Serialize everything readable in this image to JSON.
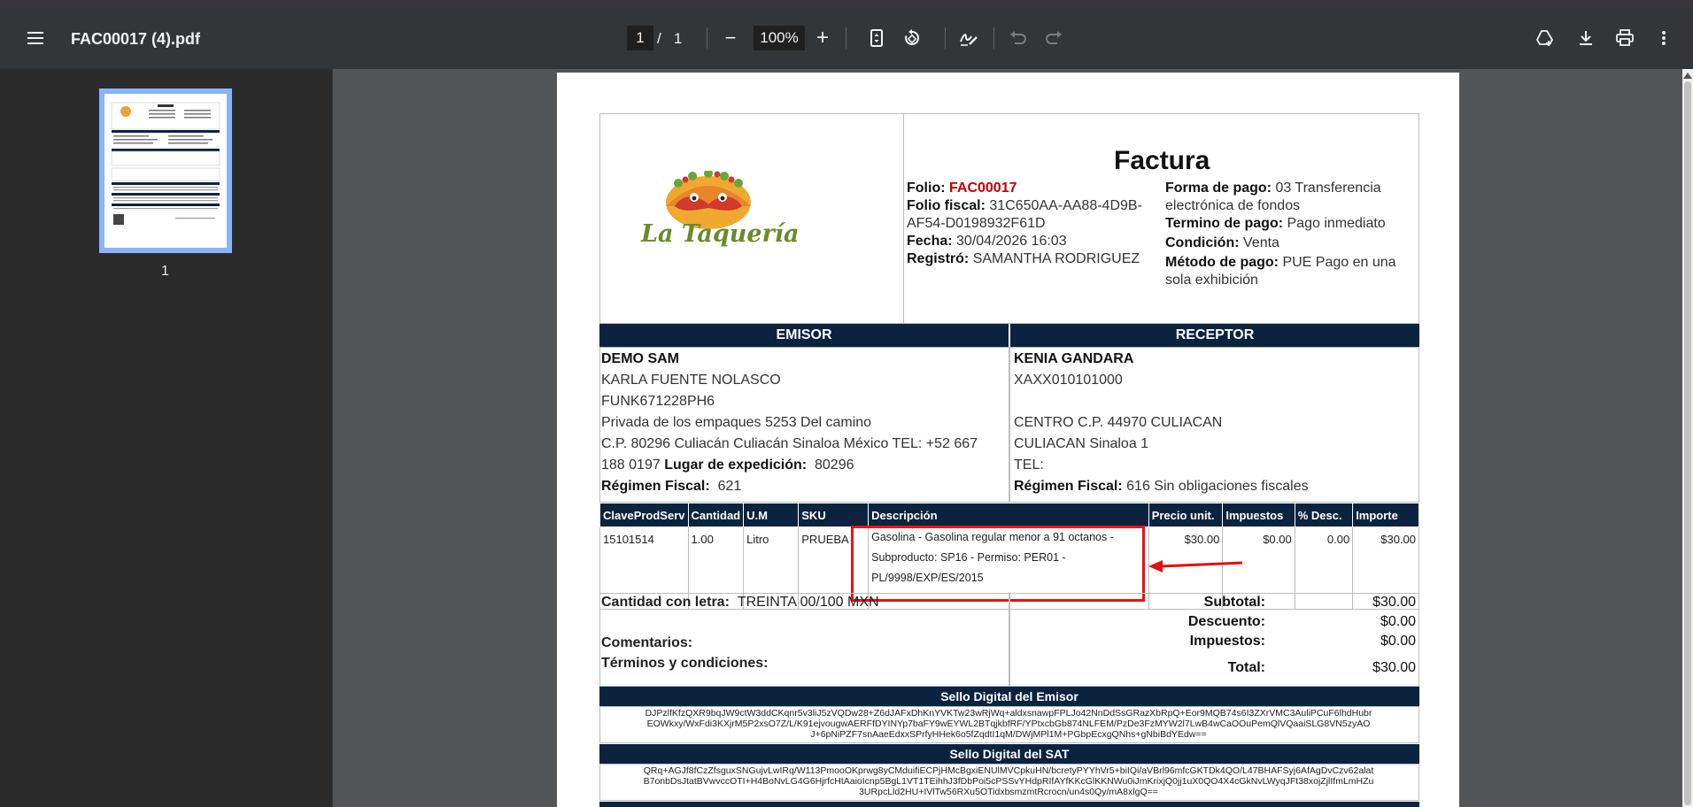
{
  "toolbar": {
    "filename": "FAC00017 (4).pdf",
    "page_current": "1",
    "page_sep": "/",
    "page_total": "1",
    "zoom": "100%",
    "zoom_out_glyph": "−",
    "zoom_in_glyph": "+",
    "icons": {
      "menu": "hamburger-menu-icon",
      "fit": "fit-to-page-icon",
      "rotate": "rotate-icon",
      "annotate": "draw-annotation-icon",
      "undo": "undo-icon",
      "redo": "redo-icon",
      "drive": "save-to-drive-icon",
      "download": "download-icon",
      "print": "print-icon",
      "more": "more-vertical-icon"
    }
  },
  "sidebar": {
    "thumbnail_label": "1"
  },
  "invoice": {
    "logo_text": "La Taquería",
    "title": "Factura",
    "left_info": {
      "folio_label": "Folio:",
      "folio_value": "FAC00017",
      "folio_fiscal_label": "Folio fiscal:",
      "folio_fiscal_value_1": "31C650AA-AA88-4D9B-",
      "folio_fiscal_value_2": "AF54-D0198932F61D",
      "fecha_label": "Fecha:",
      "fecha_value": "30/04/2026 16:03",
      "registro_label": "Registró:",
      "registro_value": "SAMANTHA RODRIGUEZ"
    },
    "right_info": {
      "forma_label": "Forma de pago:",
      "forma_value_1": "03 Transferencia",
      "forma_value_2": "electrónica de fondos",
      "termino_label": "Termino de pago:",
      "termino_value": "Pago inmediato",
      "condicion_label": "Condición:",
      "condicion_value": "Venta",
      "metodo_label": "Método de pago:",
      "metodo_value_1": "PUE Pago en una",
      "metodo_value_2": "sola exhibición"
    },
    "emisor": {
      "header": "EMISOR",
      "name": "DEMO SAM",
      "line1": "KARLA FUENTE NOLASCO",
      "line2": "FUNK671228PH6",
      "line3": "Privada de los empaques 5253 Del camino",
      "line4": "C.P. 80296 Culiacán Culiacán Sinaloa México TEL: +52 667",
      "line5_pre": "188 0197",
      "lugar_label": "Lugar de expedición:",
      "lugar_value": "80296",
      "regimen_label": "Régimen Fiscal:",
      "regimen_value": "621"
    },
    "receptor": {
      "header": "RECEPTOR",
      "name": "KENIA GANDARA",
      "line1": "XAXX010101000",
      "line2": "",
      "line3": "CENTRO C.P. 44970  CULIACAN",
      "line4": "CULIACAN Sinaloa 1",
      "line5": "TEL:",
      "regimen_label": "Régimen Fiscal:",
      "regimen_value": "616 Sin obligaciones fiscales"
    },
    "items_table": {
      "headers": [
        "ClaveProdServ",
        "Cantidad",
        "U.M",
        "SKU",
        "Descripción",
        "Precio unit.",
        "Impuestos",
        "% Desc.",
        "Importe"
      ],
      "rows": [
        {
          "clave": "15101514",
          "cantidad": "1.00",
          "um": "Litro",
          "sku": "PRUEBA",
          "descripcion_1": "Gasolina - Gasolina regular menor a 91 octanos -",
          "descripcion_2": "Subproducto: SP16 - Permiso: PER01 -",
          "descripcion_3": "PL/9998/EXP/ES/2015",
          "precio": "$30.00",
          "impuestos": "$0.00",
          "desc": "0.00",
          "importe": "$30.00"
        }
      ]
    },
    "letra_label": "Cantidad con letra:",
    "letra_value": "TREINTA 00/100 MXN",
    "comentarios_label": "Comentarios:",
    "terminos_label": "Términos y condiciones:",
    "totals": {
      "subtotal_label": "Subtotal:",
      "subtotal_value": "$30.00",
      "descuento_label": "Descuento:",
      "descuento_value": "$0.00",
      "impuestos_label": "Impuestos:",
      "impuestos_value": "$0.00",
      "total_label": "Total:",
      "total_value": "$30.00"
    },
    "sello_emisor": {
      "header": "Sello Digital del Emisor",
      "line1": "DJPzlfKfzQXR9bqJW9ctW3ddCKqnr5v3liJ5zVQDw28+Z6dJAFxDhKnYVKTw23wRjWq+aldxsnawpFPLJo42NnDdSsGRazXbRpQ+Eor9MQB74s6I3ZXrVMC3AuliPCuF6lhdHubr",
      "line2": "EOWkxy/WxFdi3KXjrM5P2xsO7Z/L/K91ejvougwAERFfDYINYp7baFY9wEYWL2BTqjkbfRF/YPtxcbGb874NLFEM/PzDe3FzMYW2l7LwB4wCaOOuPemQlVQaaiSLG8VN5zyAO",
      "line3": "J+6pNiPZF7snAaeEdxxSPrfyHHek6o5fZqdtI1qM/DWjMPl1M+PGbpEcxgQNhs+gNbiBdYEdw=="
    },
    "sello_sat": {
      "header": "Sello Digital del SAT",
      "line1": "QRq+AGJf8fCzZfsguxSNGujvLwIRq/W113PmooOKprwg8yCMduifiECPjHMcBgxiENUlMVCpkuHN/bcretyPYYhVr5+biIQi/aVBrl96mfcGKTDk4QO/L47BHAFSyj6AfAgDvCzv62alat",
      "line2": "B7onbDsJtatBVwvccOTI+H4BoNvLG4G6HjrfcHtAaioIcnp5BgL1VT1TEihhJ3fDbPoi5cPSSvYHdpRIfAYfKKcGlKKNWu0iJmKrixjQ0jj1uX0QO4X4cGkNvLWyqJFt38xojZjlIfmLmHZu",
      "line3": "3URpcLld2HU+IVlTw56RXu5OTidxbsmzmtRcrocn/un4s0Qy/mA8xlgQ=="
    },
    "colors": {
      "header_bar": "#0c2340",
      "folio_red": "#c00000",
      "annotation_red": "#e11111",
      "logo_green": "#6a8a2c"
    }
  }
}
